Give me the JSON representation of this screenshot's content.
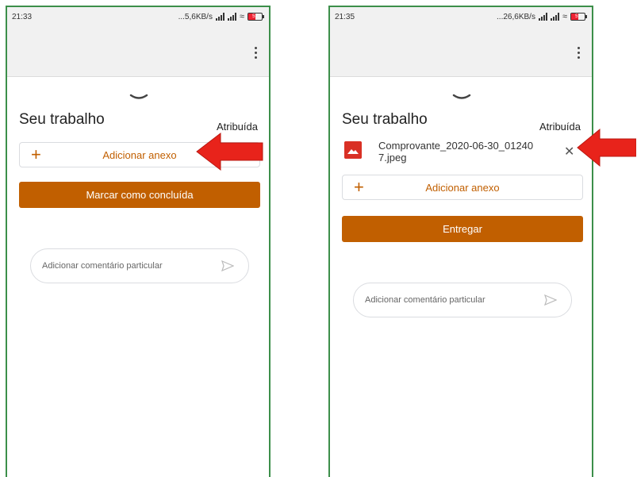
{
  "left": {
    "status_time": "21:33",
    "status_speed": "...5,6KB/s",
    "battery_level": "57",
    "section_title": "Seu trabalho",
    "section_status": "Atribuída",
    "attach_label": "Adicionar anexo",
    "primary_label": "Marcar como concluída",
    "comment_placeholder": "Adicionar comentário particular"
  },
  "right": {
    "status_time": "21:35",
    "status_speed": "...26,6KB/s",
    "battery_level": "57",
    "section_title": "Seu trabalho",
    "section_status": "Atribuída",
    "file_name": "Comprovante_2020-06-30_012407.jpeg",
    "attach_label": "Adicionar anexo",
    "primary_label": "Entregar",
    "comment_placeholder": "Adicionar comentário particular"
  },
  "colors": {
    "accent": "#c15f00",
    "frame": "#3c8f4a",
    "annotation_arrow": "#e8231b"
  },
  "icons": [
    "kebab-menu-icon",
    "chevron-down-icon",
    "plus-icon",
    "send-icon",
    "image-file-icon",
    "close-icon",
    "red-arrow-icon"
  ]
}
